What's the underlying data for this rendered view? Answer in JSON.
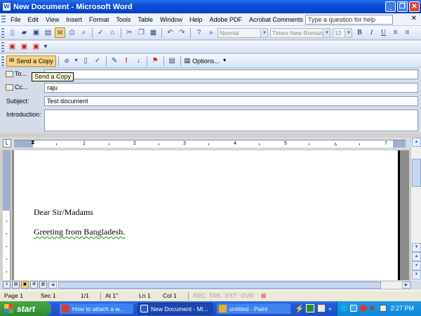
{
  "window": {
    "title": "New Document - Microsoft Word",
    "app_icon": "W"
  },
  "menu": {
    "items": [
      "File",
      "Edit",
      "View",
      "Insert",
      "Format",
      "Tools",
      "Table",
      "Window",
      "Help",
      "Adobe PDF",
      "Acrobat Comments"
    ],
    "help_placeholder": "Type a question for help"
  },
  "formatting": {
    "style": "Normal",
    "font": "Times New Roman",
    "size": "12"
  },
  "email_toolbar": {
    "send_label": "Send a Copy",
    "options_label": "Options..."
  },
  "tooltip": "Send a Copy",
  "email": {
    "to_label": "To...",
    "to_value": "",
    "cc_label": "Cc...",
    "cc_value": "raju",
    "subject_label": "Subject:",
    "subject_value": "Test document",
    "intro_label": "Introduction:",
    "intro_value": ""
  },
  "ruler": {
    "numbers": [
      "1",
      "2",
      "3",
      "4",
      "5",
      "7"
    ]
  },
  "document": {
    "line1": "Dear Sir/Madams",
    "line2": "Greeting from Bangladesh."
  },
  "status": {
    "page": "Page 1",
    "sec": "Sec 1",
    "pages": "1/1",
    "at": "At 1\"",
    "ln": "Ln 1",
    "col": "Col 1",
    "rec": "REC",
    "trk": "TRK",
    "ext": "EXT",
    "ovr": "OVR"
  },
  "taskbar": {
    "start": "start",
    "tasks": [
      {
        "label": "How to attach a w...",
        "icon_color": "#d83a2a"
      },
      {
        "label": "New Document - Mi...",
        "icon_color": "#2a5cc8"
      },
      {
        "label": "untitled - Paint",
        "icon_color": "#e8b020"
      }
    ],
    "clock": "2:27 PM"
  }
}
